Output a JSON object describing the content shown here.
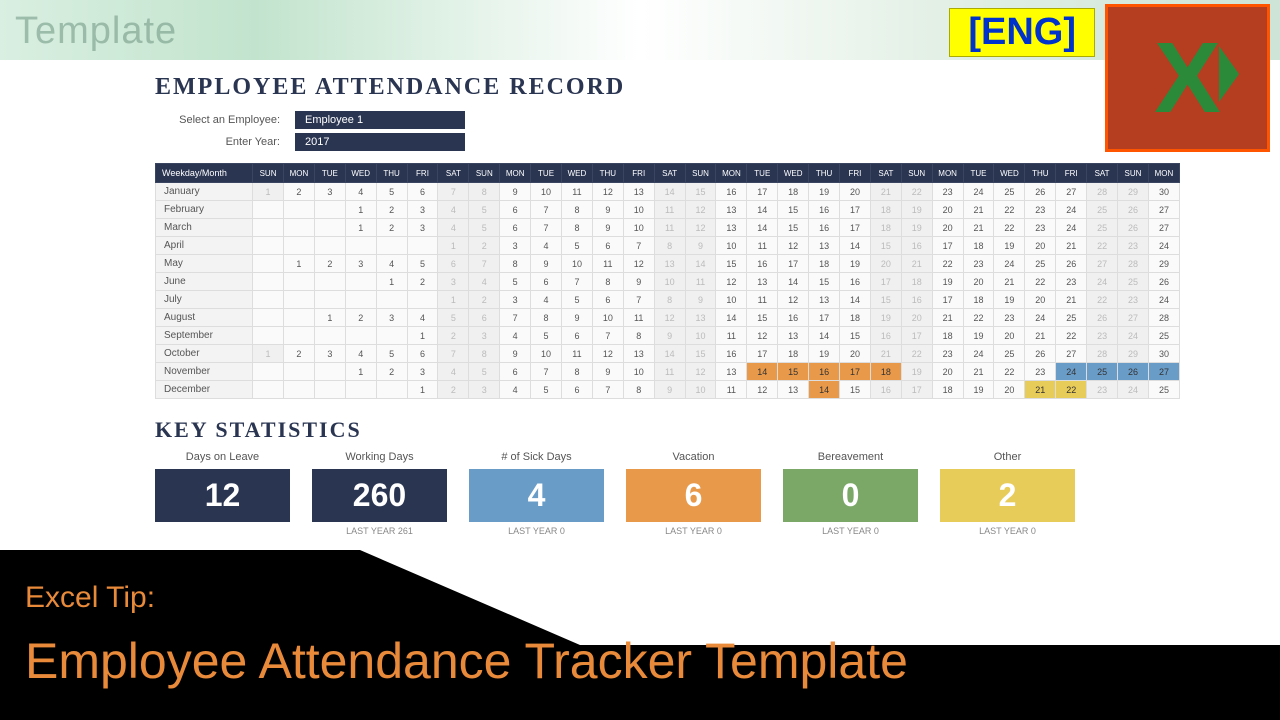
{
  "watermark": "Template",
  "lang_badge": "[ENG]",
  "title": "EMPLOYEE ATTENDANCE RECORD",
  "form": {
    "employee_label": "Select an Employee:",
    "employee_value": "Employee 1",
    "year_label": "Enter Year:",
    "year_value": "2017"
  },
  "weekday_header": "Weekday/Month",
  "days": [
    "SUN",
    "MON",
    "TUE",
    "WED",
    "THU",
    "FRI",
    "SAT",
    "SUN",
    "MON",
    "TUE",
    "WED",
    "THU",
    "FRI",
    "SAT",
    "SUN",
    "MON",
    "TUE",
    "WED",
    "THU",
    "FRI",
    "SAT",
    "SUN",
    "MON",
    "TUE",
    "WED",
    "THU",
    "FRI",
    "SAT",
    "SUN",
    "MON"
  ],
  "months": [
    {
      "name": "January",
      "cells": [
        {
          "v": "1",
          "dim": true
        },
        {
          "v": "2"
        },
        {
          "v": "3"
        },
        {
          "v": "4"
        },
        {
          "v": "5"
        },
        {
          "v": "6"
        },
        {
          "v": "7",
          "dim": true
        },
        {
          "v": "8",
          "dim": true
        },
        {
          "v": "9"
        },
        {
          "v": "10"
        },
        {
          "v": "11"
        },
        {
          "v": "12"
        },
        {
          "v": "13"
        },
        {
          "v": "14",
          "dim": true
        },
        {
          "v": "15",
          "dim": true
        },
        {
          "v": "16"
        },
        {
          "v": "17"
        },
        {
          "v": "18"
        },
        {
          "v": "19"
        },
        {
          "v": "20"
        },
        {
          "v": "21",
          "dim": true
        },
        {
          "v": "22",
          "dim": true
        },
        {
          "v": "23"
        },
        {
          "v": "24"
        },
        {
          "v": "25"
        },
        {
          "v": "26"
        },
        {
          "v": "27"
        },
        {
          "v": "28",
          "dim": true
        },
        {
          "v": "29",
          "dim": true
        },
        {
          "v": "30"
        }
      ]
    },
    {
      "name": "February",
      "cells": [
        {
          "v": ""
        },
        {
          "v": ""
        },
        {
          "v": ""
        },
        {
          "v": "1"
        },
        {
          "v": "2"
        },
        {
          "v": "3"
        },
        {
          "v": "4",
          "dim": true
        },
        {
          "v": "5",
          "dim": true
        },
        {
          "v": "6"
        },
        {
          "v": "7"
        },
        {
          "v": "8"
        },
        {
          "v": "9"
        },
        {
          "v": "10"
        },
        {
          "v": "11",
          "dim": true
        },
        {
          "v": "12",
          "dim": true
        },
        {
          "v": "13"
        },
        {
          "v": "14"
        },
        {
          "v": "15"
        },
        {
          "v": "16"
        },
        {
          "v": "17"
        },
        {
          "v": "18",
          "dim": true
        },
        {
          "v": "19",
          "dim": true
        },
        {
          "v": "20"
        },
        {
          "v": "21"
        },
        {
          "v": "22"
        },
        {
          "v": "23"
        },
        {
          "v": "24"
        },
        {
          "v": "25",
          "dim": true
        },
        {
          "v": "26",
          "dim": true
        },
        {
          "v": "27"
        }
      ]
    },
    {
      "name": "March",
      "cells": [
        {
          "v": ""
        },
        {
          "v": ""
        },
        {
          "v": ""
        },
        {
          "v": "1"
        },
        {
          "v": "2"
        },
        {
          "v": "3"
        },
        {
          "v": "4",
          "dim": true
        },
        {
          "v": "5",
          "dim": true
        },
        {
          "v": "6"
        },
        {
          "v": "7"
        },
        {
          "v": "8"
        },
        {
          "v": "9"
        },
        {
          "v": "10"
        },
        {
          "v": "11",
          "dim": true
        },
        {
          "v": "12",
          "dim": true
        },
        {
          "v": "13"
        },
        {
          "v": "14"
        },
        {
          "v": "15"
        },
        {
          "v": "16"
        },
        {
          "v": "17"
        },
        {
          "v": "18",
          "dim": true
        },
        {
          "v": "19",
          "dim": true
        },
        {
          "v": "20"
        },
        {
          "v": "21"
        },
        {
          "v": "22"
        },
        {
          "v": "23"
        },
        {
          "v": "24"
        },
        {
          "v": "25",
          "dim": true
        },
        {
          "v": "26",
          "dim": true
        },
        {
          "v": "27"
        }
      ]
    },
    {
      "name": "April",
      "cells": [
        {
          "v": ""
        },
        {
          "v": ""
        },
        {
          "v": ""
        },
        {
          "v": ""
        },
        {
          "v": ""
        },
        {
          "v": ""
        },
        {
          "v": "1",
          "dim": true
        },
        {
          "v": "2",
          "dim": true
        },
        {
          "v": "3"
        },
        {
          "v": "4"
        },
        {
          "v": "5"
        },
        {
          "v": "6"
        },
        {
          "v": "7"
        },
        {
          "v": "8",
          "dim": true
        },
        {
          "v": "9",
          "dim": true
        },
        {
          "v": "10"
        },
        {
          "v": "11"
        },
        {
          "v": "12"
        },
        {
          "v": "13"
        },
        {
          "v": "14"
        },
        {
          "v": "15",
          "dim": true
        },
        {
          "v": "16",
          "dim": true
        },
        {
          "v": "17"
        },
        {
          "v": "18"
        },
        {
          "v": "19"
        },
        {
          "v": "20"
        },
        {
          "v": "21"
        },
        {
          "v": "22",
          "dim": true
        },
        {
          "v": "23",
          "dim": true
        },
        {
          "v": "24"
        }
      ]
    },
    {
      "name": "May",
      "cells": [
        {
          "v": ""
        },
        {
          "v": "1"
        },
        {
          "v": "2"
        },
        {
          "v": "3"
        },
        {
          "v": "4"
        },
        {
          "v": "5"
        },
        {
          "v": "6",
          "dim": true
        },
        {
          "v": "7",
          "dim": true
        },
        {
          "v": "8"
        },
        {
          "v": "9"
        },
        {
          "v": "10"
        },
        {
          "v": "11"
        },
        {
          "v": "12"
        },
        {
          "v": "13",
          "dim": true
        },
        {
          "v": "14",
          "dim": true
        },
        {
          "v": "15"
        },
        {
          "v": "16"
        },
        {
          "v": "17"
        },
        {
          "v": "18"
        },
        {
          "v": "19"
        },
        {
          "v": "20",
          "dim": true
        },
        {
          "v": "21",
          "dim": true
        },
        {
          "v": "22"
        },
        {
          "v": "23"
        },
        {
          "v": "24"
        },
        {
          "v": "25"
        },
        {
          "v": "26"
        },
        {
          "v": "27",
          "dim": true
        },
        {
          "v": "28",
          "dim": true
        },
        {
          "v": "29"
        }
      ]
    },
    {
      "name": "June",
      "cells": [
        {
          "v": ""
        },
        {
          "v": ""
        },
        {
          "v": ""
        },
        {
          "v": ""
        },
        {
          "v": "1"
        },
        {
          "v": "2"
        },
        {
          "v": "3",
          "dim": true
        },
        {
          "v": "4",
          "dim": true
        },
        {
          "v": "5"
        },
        {
          "v": "6"
        },
        {
          "v": "7"
        },
        {
          "v": "8"
        },
        {
          "v": "9"
        },
        {
          "v": "10",
          "dim": true
        },
        {
          "v": "11",
          "dim": true
        },
        {
          "v": "12"
        },
        {
          "v": "13"
        },
        {
          "v": "14"
        },
        {
          "v": "15"
        },
        {
          "v": "16"
        },
        {
          "v": "17",
          "dim": true
        },
        {
          "v": "18",
          "dim": true
        },
        {
          "v": "19"
        },
        {
          "v": "20"
        },
        {
          "v": "21"
        },
        {
          "v": "22"
        },
        {
          "v": "23"
        },
        {
          "v": "24",
          "dim": true
        },
        {
          "v": "25",
          "dim": true
        },
        {
          "v": "26"
        }
      ]
    },
    {
      "name": "July",
      "cells": [
        {
          "v": ""
        },
        {
          "v": ""
        },
        {
          "v": ""
        },
        {
          "v": ""
        },
        {
          "v": ""
        },
        {
          "v": ""
        },
        {
          "v": "1",
          "dim": true
        },
        {
          "v": "2",
          "dim": true
        },
        {
          "v": "3"
        },
        {
          "v": "4"
        },
        {
          "v": "5"
        },
        {
          "v": "6"
        },
        {
          "v": "7"
        },
        {
          "v": "8",
          "dim": true
        },
        {
          "v": "9",
          "dim": true
        },
        {
          "v": "10"
        },
        {
          "v": "11"
        },
        {
          "v": "12"
        },
        {
          "v": "13"
        },
        {
          "v": "14"
        },
        {
          "v": "15",
          "dim": true
        },
        {
          "v": "16",
          "dim": true
        },
        {
          "v": "17"
        },
        {
          "v": "18"
        },
        {
          "v": "19"
        },
        {
          "v": "20"
        },
        {
          "v": "21"
        },
        {
          "v": "22",
          "dim": true
        },
        {
          "v": "23",
          "dim": true
        },
        {
          "v": "24"
        }
      ]
    },
    {
      "name": "August",
      "cells": [
        {
          "v": ""
        },
        {
          "v": ""
        },
        {
          "v": "1"
        },
        {
          "v": "2"
        },
        {
          "v": "3"
        },
        {
          "v": "4"
        },
        {
          "v": "5",
          "dim": true
        },
        {
          "v": "6",
          "dim": true
        },
        {
          "v": "7"
        },
        {
          "v": "8"
        },
        {
          "v": "9"
        },
        {
          "v": "10"
        },
        {
          "v": "11"
        },
        {
          "v": "12",
          "dim": true
        },
        {
          "v": "13",
          "dim": true
        },
        {
          "v": "14"
        },
        {
          "v": "15"
        },
        {
          "v": "16"
        },
        {
          "v": "17"
        },
        {
          "v": "18"
        },
        {
          "v": "19",
          "dim": true
        },
        {
          "v": "20",
          "dim": true
        },
        {
          "v": "21"
        },
        {
          "v": "22"
        },
        {
          "v": "23"
        },
        {
          "v": "24"
        },
        {
          "v": "25"
        },
        {
          "v": "26",
          "dim": true
        },
        {
          "v": "27",
          "dim": true
        },
        {
          "v": "28"
        }
      ]
    },
    {
      "name": "September",
      "cells": [
        {
          "v": ""
        },
        {
          "v": ""
        },
        {
          "v": ""
        },
        {
          "v": ""
        },
        {
          "v": ""
        },
        {
          "v": "1"
        },
        {
          "v": "2",
          "dim": true
        },
        {
          "v": "3",
          "dim": true
        },
        {
          "v": "4"
        },
        {
          "v": "5"
        },
        {
          "v": "6"
        },
        {
          "v": "7"
        },
        {
          "v": "8"
        },
        {
          "v": "9",
          "dim": true
        },
        {
          "v": "10",
          "dim": true
        },
        {
          "v": "11"
        },
        {
          "v": "12"
        },
        {
          "v": "13"
        },
        {
          "v": "14"
        },
        {
          "v": "15"
        },
        {
          "v": "16",
          "dim": true
        },
        {
          "v": "17",
          "dim": true
        },
        {
          "v": "18"
        },
        {
          "v": "19"
        },
        {
          "v": "20"
        },
        {
          "v": "21"
        },
        {
          "v": "22"
        },
        {
          "v": "23",
          "dim": true
        },
        {
          "v": "24",
          "dim": true
        },
        {
          "v": "25"
        }
      ]
    },
    {
      "name": "October",
      "cells": [
        {
          "v": "1",
          "dim": true
        },
        {
          "v": "2"
        },
        {
          "v": "3"
        },
        {
          "v": "4"
        },
        {
          "v": "5"
        },
        {
          "v": "6"
        },
        {
          "v": "7",
          "dim": true
        },
        {
          "v": "8",
          "dim": true
        },
        {
          "v": "9"
        },
        {
          "v": "10"
        },
        {
          "v": "11"
        },
        {
          "v": "12"
        },
        {
          "v": "13"
        },
        {
          "v": "14",
          "dim": true
        },
        {
          "v": "15",
          "dim": true
        },
        {
          "v": "16"
        },
        {
          "v": "17"
        },
        {
          "v": "18"
        },
        {
          "v": "19"
        },
        {
          "v": "20"
        },
        {
          "v": "21",
          "dim": true
        },
        {
          "v": "22",
          "dim": true
        },
        {
          "v": "23"
        },
        {
          "v": "24"
        },
        {
          "v": "25"
        },
        {
          "v": "26"
        },
        {
          "v": "27"
        },
        {
          "v": "28",
          "dim": true
        },
        {
          "v": "29",
          "dim": true
        },
        {
          "v": "30"
        }
      ]
    },
    {
      "name": "November",
      "cells": [
        {
          "v": ""
        },
        {
          "v": ""
        },
        {
          "v": ""
        },
        {
          "v": "1"
        },
        {
          "v": "2"
        },
        {
          "v": "3"
        },
        {
          "v": "4",
          "dim": true
        },
        {
          "v": "5",
          "dim": true
        },
        {
          "v": "6"
        },
        {
          "v": "7"
        },
        {
          "v": "8"
        },
        {
          "v": "9"
        },
        {
          "v": "10"
        },
        {
          "v": "11",
          "dim": true
        },
        {
          "v": "12",
          "dim": true
        },
        {
          "v": "13"
        },
        {
          "v": "14",
          "cls": "hl-orange"
        },
        {
          "v": "15",
          "cls": "hl-orange"
        },
        {
          "v": "16",
          "cls": "hl-orange"
        },
        {
          "v": "17",
          "cls": "hl-orange"
        },
        {
          "v": "18",
          "cls": "hl-orange"
        },
        {
          "v": "19",
          "dim": true
        },
        {
          "v": "20"
        },
        {
          "v": "21"
        },
        {
          "v": "22"
        },
        {
          "v": "23"
        },
        {
          "v": "24",
          "cls": "hl-blue"
        },
        {
          "v": "25",
          "cls": "hl-blue"
        },
        {
          "v": "26",
          "cls": "hl-blue"
        },
        {
          "v": "27",
          "cls": "hl-blue"
        }
      ]
    },
    {
      "name": "December",
      "cells": [
        {
          "v": ""
        },
        {
          "v": ""
        },
        {
          "v": ""
        },
        {
          "v": ""
        },
        {
          "v": ""
        },
        {
          "v": "1"
        },
        {
          "v": "2",
          "dim": true
        },
        {
          "v": "3",
          "dim": true
        },
        {
          "v": "4"
        },
        {
          "v": "5"
        },
        {
          "v": "6"
        },
        {
          "v": "7"
        },
        {
          "v": "8"
        },
        {
          "v": "9",
          "dim": true
        },
        {
          "v": "10",
          "dim": true
        },
        {
          "v": "11"
        },
        {
          "v": "12"
        },
        {
          "v": "13"
        },
        {
          "v": "14",
          "cls": "hl-orange"
        },
        {
          "v": "15"
        },
        {
          "v": "16",
          "dim": true
        },
        {
          "v": "17",
          "dim": true
        },
        {
          "v": "18"
        },
        {
          "v": "19"
        },
        {
          "v": "20"
        },
        {
          "v": "21",
          "cls": "hl-yellow"
        },
        {
          "v": "22",
          "cls": "hl-yellow"
        },
        {
          "v": "23",
          "dim": true
        },
        {
          "v": "24",
          "dim": true
        },
        {
          "v": "25"
        }
      ]
    }
  ],
  "stats_title": "KEY STATISTICS",
  "stats": [
    {
      "label": "Days on Leave",
      "value": "12",
      "cls": "dark",
      "sub": ""
    },
    {
      "label": "Working Days",
      "value": "260",
      "cls": "dark",
      "sub": "LAST YEAR  261"
    },
    {
      "label": "# of Sick Days",
      "value": "4",
      "cls": "blue",
      "sub": "LAST YEAR  0"
    },
    {
      "label": "Vacation",
      "value": "6",
      "cls": "orange",
      "sub": "LAST YEAR  0"
    },
    {
      "label": "Bereavement",
      "value": "0",
      "cls": "green",
      "sub": "LAST YEAR  0"
    },
    {
      "label": "Other",
      "value": "2",
      "cls": "yellow",
      "sub": "LAST YEAR  0"
    }
  ],
  "banner": {
    "tip": "Excel Tip:",
    "title": "Employee Attendance Tracker Template"
  }
}
